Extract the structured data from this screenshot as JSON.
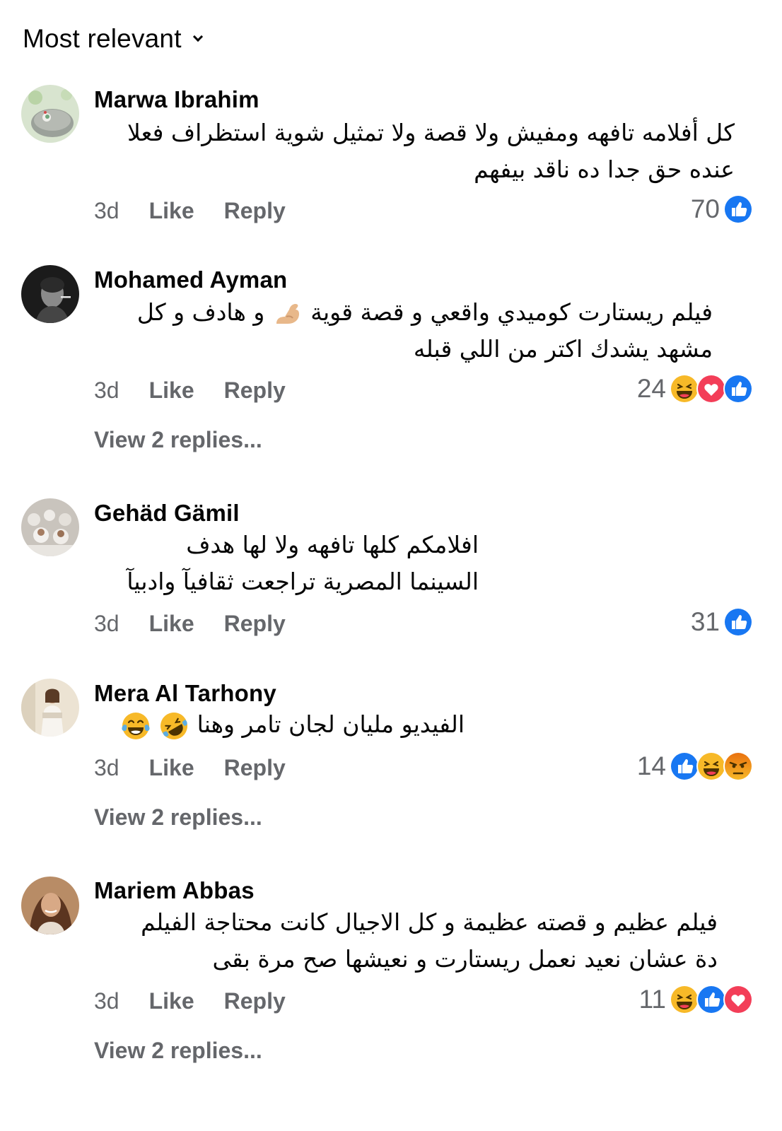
{
  "sort": {
    "label": "Most relevant"
  },
  "action_labels": {
    "like": "Like",
    "reply": "Reply"
  },
  "colors": {
    "like_blue": "#1877f2",
    "love_red": "#f33e58",
    "haha_yellow": "#f7b928",
    "angry_orange": "#e9710f",
    "secondary_text": "#65676b"
  },
  "comments": [
    {
      "author": "Marwa Ibrahim",
      "lines": [
        "كل أفلامه تافهه ومفيش ولا قصة ولا تمثيل شوية استظراف فعلا",
        "عنده حق جدا ده ناقد بيفهم"
      ],
      "time": "3d",
      "reaction_count": "70",
      "reactions": [
        "like-icon"
      ]
    },
    {
      "author": "Mohamed Ayman",
      "lines": [
        "فيلم ريستارت كوميدي واقعي و قصة قوية",
        "و هادف و كل",
        "مشهد يشدك اكتر من اللي قبله"
      ],
      "emoji": [
        "flexed-biceps-emoji"
      ],
      "time": "3d",
      "reaction_count": "24",
      "reactions": [
        "haha-icon",
        "love-icon",
        "like-icon"
      ],
      "view_replies": "View 2 replies..."
    },
    {
      "author": "Gehäd Gämil",
      "lines": [
        "افلامكم كلها تافهه ولا لها هدف",
        "السينما المصرية تراجعت ثقافيآ وادبيآ"
      ],
      "time": "3d",
      "reaction_count": "31",
      "reactions": [
        "like-icon"
      ]
    },
    {
      "author": "Mera Al Tarhony",
      "lines": [
        "الفيديو مليان لجان تامر وهنا"
      ],
      "emoji": [
        "rolling-laughing-emoji",
        "tears-of-joy-emoji"
      ],
      "time": "3d",
      "reaction_count": "14",
      "reactions": [
        "like-icon",
        "haha-icon",
        "angry-icon"
      ],
      "view_replies": "View 2 replies..."
    },
    {
      "author": "Mariem Abbas",
      "lines": [
        "فيلم عظيم و قصته عظيمة و كل الاجيال كانت محتاجة الفيلم",
        "دة عشان نعيد نعمل ريستارت و نعيشها صح مرة بقى"
      ],
      "time": "3d",
      "reaction_count": "11",
      "reactions": [
        "haha-icon",
        "like-icon",
        "love-icon"
      ],
      "view_replies": "View 2 replies..."
    }
  ]
}
